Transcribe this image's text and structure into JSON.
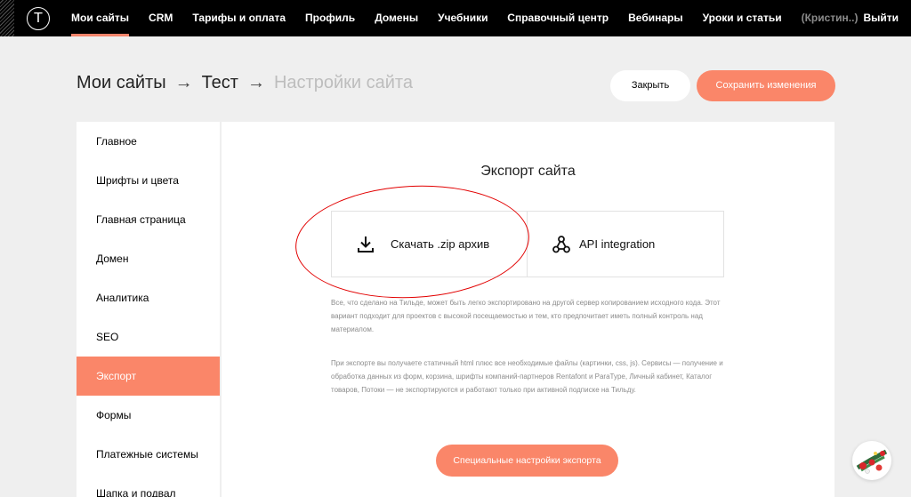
{
  "topnav": {
    "left": [
      "Мои сайты",
      "CRM",
      "Тарифы и оплата",
      "Профиль",
      "Домены",
      "Учебники"
    ],
    "right": [
      "Справочный центр",
      "Вебинары",
      "Уроки и статьи"
    ],
    "user": "(Кристин..)",
    "logout": "Выйти",
    "active_index": 0
  },
  "breadcrumb": {
    "items": [
      "Мои сайты",
      "Тест",
      "Настройки сайта"
    ],
    "separator": "→"
  },
  "actions": {
    "close_label": "Закрыть",
    "save_label": "Сохранить изменения"
  },
  "sidebar": {
    "items": [
      "Главное",
      "Шрифты и цвета",
      "Главная страница",
      "Домен",
      "Аналитика",
      "SEO",
      "Экспорт",
      "Формы",
      "Платежные системы",
      "Шапка и подвал"
    ],
    "active_index": 6
  },
  "export": {
    "title": "Экспорт сайта",
    "zip_label": "Скачать .zip архив",
    "api_label": "API integration",
    "desc1": "Все, что сделано на Тильде, может быть легко экспортировано на другой сервер копированием исходного кода. Этот вариант подходит для проектов с высокой посещаемостью и тем, кто предпочитает иметь полный контроль над материалом.",
    "desc2": "При экспорте вы получаете статичный html плюс все необходимые файлы (картинки, css, js). Сервисы — получение и обработка данных из форм, корзина, шрифты компаний-партнеров Rentafont и ParaType, Личный кабинет, Каталог товаров, Потоки — не экспортируются и работают только при активной подписке на Тильду.",
    "special_button": "Специальные настройки экспорта"
  },
  "colors": {
    "accent": "#fa8669",
    "topbar": "#000000",
    "background": "#efefef",
    "annotation": "#e20000"
  },
  "icons": {
    "logo": "tilda-logo-icon",
    "zip": "download-icon",
    "api": "api-nodes-icon",
    "corner": "holiday-decoration-icon"
  }
}
